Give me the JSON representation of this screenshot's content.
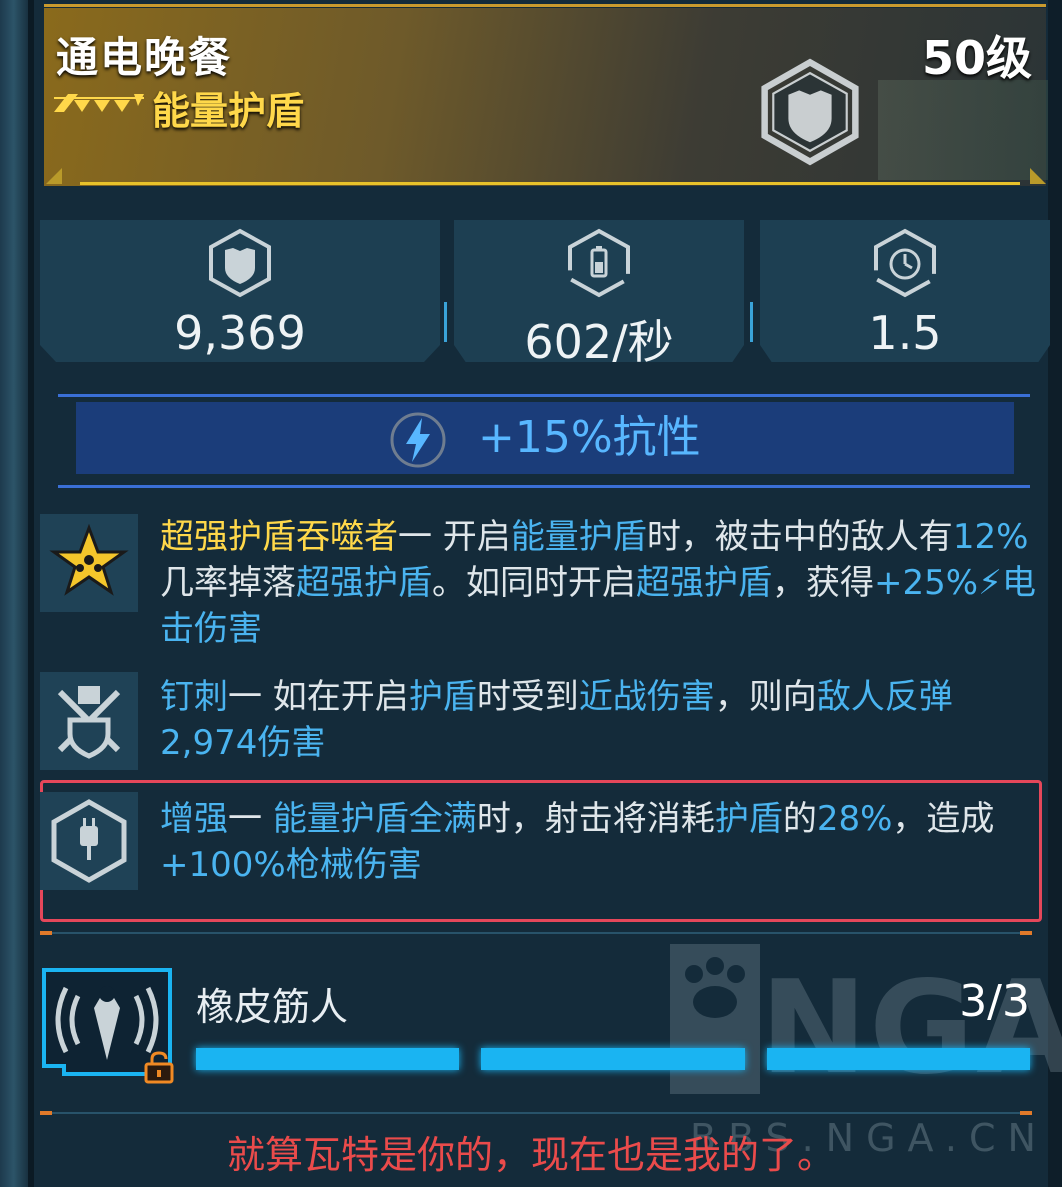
{
  "item": {
    "name": "通电晚餐",
    "level": "50级",
    "type": "能量护盾",
    "rarity_color": "#ffd84a"
  },
  "stats": [
    {
      "icon": "shield-capacity-icon",
      "value": "9,369"
    },
    {
      "icon": "recharge-rate-icon",
      "value": "602/秒"
    },
    {
      "icon": "recharge-delay-icon",
      "value": "1.5"
    }
  ],
  "resistance": {
    "icon": "shock-icon",
    "text": "+15%抗性"
  },
  "perks": [
    {
      "icon": "star-badge-icon",
      "segments": [
        {
          "t": "超强护盾吞噬者",
          "c": "gold"
        },
        {
          "t": "一 开启",
          "c": ""
        },
        {
          "t": "能量护盾",
          "c": "blue"
        },
        {
          "t": "时，被击中的敌人有",
          "c": ""
        },
        {
          "t": "12%",
          "c": "blue"
        },
        {
          "t": "几率掉落",
          "c": ""
        },
        {
          "t": "超强护盾",
          "c": "blue"
        },
        {
          "t": "。如同时开启",
          "c": ""
        },
        {
          "t": "超强护盾",
          "c": "blue"
        },
        {
          "t": "，获得",
          "c": ""
        },
        {
          "t": "+25%",
          "c": "blue"
        },
        {
          "t": "⚡",
          "c": "blue"
        },
        {
          "t": "电击伤害",
          "c": "blue"
        }
      ]
    },
    {
      "icon": "spike-shield-icon",
      "segments": [
        {
          "t": "钉刺",
          "c": "blue"
        },
        {
          "t": "一 如在开启",
          "c": ""
        },
        {
          "t": "护盾",
          "c": "blue"
        },
        {
          "t": "时受到",
          "c": ""
        },
        {
          "t": "近战伤害",
          "c": "blue"
        },
        {
          "t": "，则向",
          "c": ""
        },
        {
          "t": "敌人反弹",
          "c": "blue"
        },
        {
          "t": "2,974伤害",
          "c": "blue"
        }
      ]
    },
    {
      "icon": "amp-shield-icon",
      "highlighted": true,
      "highlight_color": "#e5475a",
      "segments": [
        {
          "t": "增强",
          "c": "blue"
        },
        {
          "t": "一 ",
          "c": ""
        },
        {
          "t": "能量护盾全满",
          "c": "blue"
        },
        {
          "t": "时，射击将消耗",
          "c": ""
        },
        {
          "t": "护盾",
          "c": "blue"
        },
        {
          "t": "的",
          "c": ""
        },
        {
          "t": "28%",
          "c": "blue"
        },
        {
          "t": "，造成",
          "c": ""
        },
        {
          "t": "+100%",
          "c": "blue"
        },
        {
          "t": "枪械伤害",
          "c": "blue"
        }
      ]
    }
  ],
  "manufacturer": {
    "icon": "manufacturer-signal-icon",
    "lock_icon": "lock-icon",
    "name": "橡皮筋人",
    "count": "3/3",
    "bars_filled": 3,
    "bars_total": 3,
    "bar_color": "#1ab4f2"
  },
  "watermark": {
    "logo_text": "NGA",
    "url": "BBS.NGA.CN"
  },
  "quote": "就算瓦特是你的，现在也是我的了。"
}
